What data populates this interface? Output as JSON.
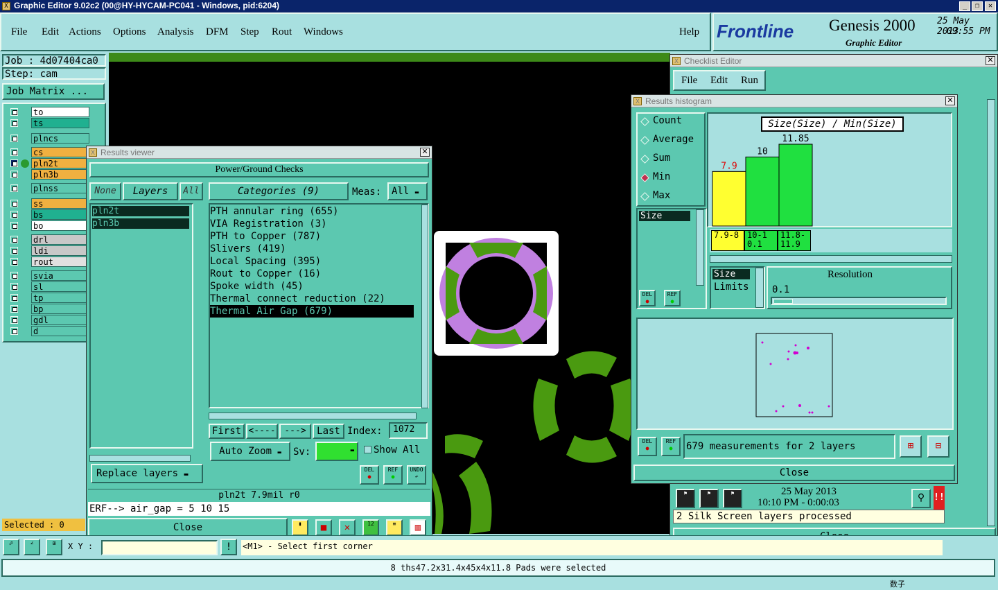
{
  "app": {
    "title": "Graphic Editor 9.02c2 (00@HY-HYCAM-PC041 - Windows, pid:6204)"
  },
  "menu": [
    "File",
    "Edit",
    "Actions",
    "Options",
    "Analysis",
    "DFM",
    "Step",
    "Rout",
    "Windows"
  ],
  "help": "Help",
  "brand": {
    "logo": "Frontline",
    "product": "Genesis 2000",
    "sub": "Graphic Editor",
    "date": "25 May 2013",
    "time": "09:55 PM"
  },
  "job": {
    "job": "Job : 4d07404ca0",
    "step": "Step: cam",
    "matrix": "Job Matrix ..."
  },
  "layers": [
    {
      "name": "to",
      "color": "#ffffff"
    },
    {
      "name": "ts",
      "color": "#20b090"
    },
    {
      "name": "plncs",
      "color": "#5cc8b0"
    },
    {
      "name": "cs",
      "color": "#f0b040"
    },
    {
      "name": "pln2t",
      "color": "#f0b040"
    },
    {
      "name": "pln3b",
      "color": "#f0b040"
    },
    {
      "name": "plnss",
      "color": "#5cc8b0"
    },
    {
      "name": "ss",
      "color": "#f0b040"
    },
    {
      "name": "bs",
      "color": "#20b090"
    },
    {
      "name": "bo",
      "color": "#ffffff"
    },
    {
      "name": "drl",
      "color": "#c8c8c8"
    },
    {
      "name": "ldi",
      "color": "#c8c8c8"
    },
    {
      "name": "rout",
      "color": "#e0e0e0"
    },
    {
      "name": "svia",
      "color": "#5cc8b0"
    },
    {
      "name": "sl",
      "color": "#5cc8b0"
    },
    {
      "name": "tp",
      "color": "#5cc8b0"
    },
    {
      "name": "bp",
      "color": "#5cc8b0"
    },
    {
      "name": "gdl",
      "color": "#5cc8b0"
    },
    {
      "name": "d",
      "color": "#5cc8b0"
    }
  ],
  "selected": "Selected : 0",
  "results_viewer": {
    "title": "Results viewer",
    "header": "Power/Ground Checks",
    "none": "None",
    "layers": "Layers",
    "all": "All",
    "layer_list": [
      "pln2t",
      "pln3b"
    ],
    "categories_btn": "Categories (9)",
    "meas_label": "Meas:",
    "meas_value": "All",
    "categories": [
      "PTH annular ring (655)",
      "VIA Registration (3)",
      "PTH to Copper (787)",
      "Slivers (419)",
      "Local Spacing (395)",
      "Rout to Copper (16)",
      "Spoke width (45)",
      "Thermal connect reduction (22)",
      "Thermal Air Gap (679)"
    ],
    "first": "First",
    "prev": "<----",
    "next": "--->",
    "last": "Last",
    "index_label": "Index:",
    "index_value": "1072",
    "autozoom": "Auto Zoom",
    "sv": "Sv:",
    "showall": "Show All",
    "replace": "Replace layers",
    "status": "pln2t 7.9mil  r0",
    "erf": "ERF--> air_gap = 5 10 15",
    "close": "Close",
    "del": "DEL",
    "ref": "REF",
    "undo": "UNDO"
  },
  "checklist": {
    "title": "Checklist Editor",
    "menu": [
      "File",
      "Edit",
      "Run"
    ],
    "date": "25 May 2013",
    "time": "10:10 PM - 0:00:03",
    "msg": "2 Silk Screen layers processed",
    "close": "Close"
  },
  "histogram": {
    "title": "Results histogram",
    "options": [
      "Count",
      "Average",
      "Sum",
      "Min",
      "Max"
    ],
    "selected": "Min",
    "list_item": "Size",
    "chart_title": "Size(Size) / Min(Size)",
    "size_label": "Size",
    "limits_label": "Limits",
    "resolution_label": "Resolution",
    "resolution_value": "0.1",
    "measurements": "679 measurements for 2 layers",
    "close": "Close"
  },
  "chart_data": {
    "type": "bar",
    "title": "Size(Size) / Min(Size)",
    "categories": [
      "7.9-8",
      "10-10.1",
      "11.8-11.9"
    ],
    "values": [
      7.9,
      10,
      11.85
    ],
    "colors": [
      "#ffff30",
      "#20e040",
      "#20e040"
    ],
    "value_colors": [
      "#e00000",
      "#000000",
      "#000000"
    ]
  },
  "toolbar": {
    "xy": "X Y :",
    "hint": "<M1> - Select first corner"
  },
  "status_bottom": "8 ths47.2x31.4x45x4x11.8 Pads were selected",
  "ime": "数子"
}
